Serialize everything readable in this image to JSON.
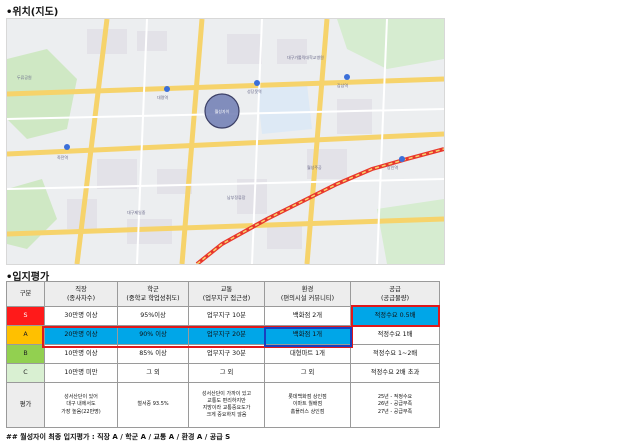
{
  "section_location": {
    "bullet": "•",
    "title": "위치(지도)"
  },
  "section_evaluation": {
    "bullet": "•",
    "title": "입지평가"
  },
  "map": {
    "marker_label": "월성자이",
    "place_labels": [
      "두류공원",
      "대구가톨릭대학교병원",
      "대명역",
      "성당못역",
      "감삼역",
      "죽전역",
      "월성주공",
      "대구제일중",
      "남부정류장",
      "상인역"
    ]
  },
  "table": {
    "header": [
      {
        "line1": "구분",
        "line2": ""
      },
      {
        "line1": "직장",
        "line2": "(종사자수)"
      },
      {
        "line1": "학군",
        "line2": "(중학교 학업성취도)"
      },
      {
        "line1": "교통",
        "line2": "(업무지구 접근성)"
      },
      {
        "line1": "환경",
        "line2": "(편의시설 커뮤니티)"
      },
      {
        "line1": "공급",
        "line2": "(공급물량)"
      }
    ],
    "rows": [
      {
        "grade": "S",
        "cells": [
          "30만명 이상",
          "95%이상",
          "업무지구 10분",
          "백화점 2개",
          "적정수요 0.5배"
        ]
      },
      {
        "grade": "A",
        "cells": [
          "20만명 이상",
          "90% 이상",
          "업무지구 20분",
          "백화점 1개",
          "적정수요 1배"
        ]
      },
      {
        "grade": "B",
        "cells": [
          "10만명 이상",
          "85% 이상",
          "업무지구 30분",
          "대형마트 1개",
          "적정수요 1~2배"
        ]
      },
      {
        "grade": "C",
        "cells": [
          "10만명 미만",
          "그 외",
          "그 외",
          "그 외",
          "적정수요 2배 초과"
        ]
      }
    ],
    "evaluation": {
      "label": "평가",
      "cells": [
        [
          "성서산단이 있어",
          "대구 내에서도",
          "가장 높음(22만명)"
        ],
        [
          "철서중 93.5%"
        ],
        [
          "성서산단이 가까이 있고",
          "교통도 편리하지만",
          "지방이라 교통중요도가",
          "크게 중요하지 않음"
        ],
        [
          "롯데백화점 상인점",
          "이마트 월배점",
          "홈플러스 상인점"
        ],
        [
          "25년 - 적정수요",
          "26년 - 공급부족",
          "27년 - 공급부족"
        ]
      ]
    }
  },
  "footer": "## 월성자이 최종 입지평가 : 직장 A / 학군 A / 교통 A / 환경 A / 공급 S"
}
